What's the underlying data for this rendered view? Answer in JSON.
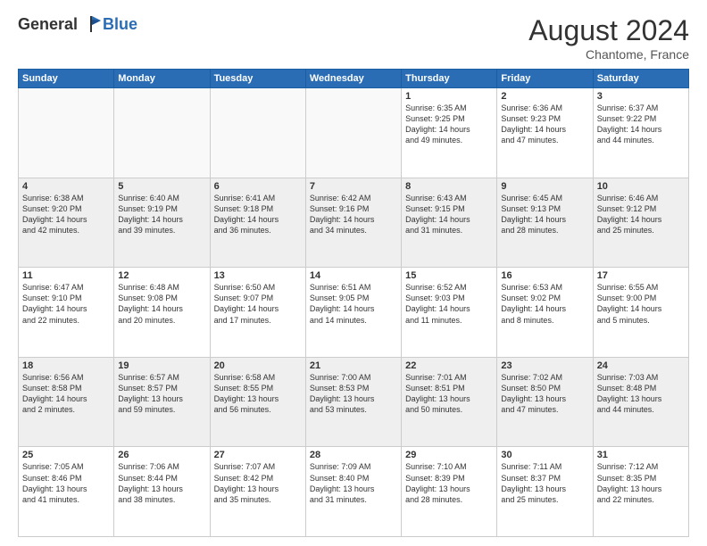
{
  "header": {
    "logo_general": "General",
    "logo_blue": "Blue",
    "month_title": "August 2024",
    "location": "Chantome, France"
  },
  "weekdays": [
    "Sunday",
    "Monday",
    "Tuesday",
    "Wednesday",
    "Thursday",
    "Friday",
    "Saturday"
  ],
  "rows": [
    [
      {
        "num": "",
        "info": ""
      },
      {
        "num": "",
        "info": ""
      },
      {
        "num": "",
        "info": ""
      },
      {
        "num": "",
        "info": ""
      },
      {
        "num": "1",
        "info": "Sunrise: 6:35 AM\nSunset: 9:25 PM\nDaylight: 14 hours\nand 49 minutes."
      },
      {
        "num": "2",
        "info": "Sunrise: 6:36 AM\nSunset: 9:23 PM\nDaylight: 14 hours\nand 47 minutes."
      },
      {
        "num": "3",
        "info": "Sunrise: 6:37 AM\nSunset: 9:22 PM\nDaylight: 14 hours\nand 44 minutes."
      }
    ],
    [
      {
        "num": "4",
        "info": "Sunrise: 6:38 AM\nSunset: 9:20 PM\nDaylight: 14 hours\nand 42 minutes."
      },
      {
        "num": "5",
        "info": "Sunrise: 6:40 AM\nSunset: 9:19 PM\nDaylight: 14 hours\nand 39 minutes."
      },
      {
        "num": "6",
        "info": "Sunrise: 6:41 AM\nSunset: 9:18 PM\nDaylight: 14 hours\nand 36 minutes."
      },
      {
        "num": "7",
        "info": "Sunrise: 6:42 AM\nSunset: 9:16 PM\nDaylight: 14 hours\nand 34 minutes."
      },
      {
        "num": "8",
        "info": "Sunrise: 6:43 AM\nSunset: 9:15 PM\nDaylight: 14 hours\nand 31 minutes."
      },
      {
        "num": "9",
        "info": "Sunrise: 6:45 AM\nSunset: 9:13 PM\nDaylight: 14 hours\nand 28 minutes."
      },
      {
        "num": "10",
        "info": "Sunrise: 6:46 AM\nSunset: 9:12 PM\nDaylight: 14 hours\nand 25 minutes."
      }
    ],
    [
      {
        "num": "11",
        "info": "Sunrise: 6:47 AM\nSunset: 9:10 PM\nDaylight: 14 hours\nand 22 minutes."
      },
      {
        "num": "12",
        "info": "Sunrise: 6:48 AM\nSunset: 9:08 PM\nDaylight: 14 hours\nand 20 minutes."
      },
      {
        "num": "13",
        "info": "Sunrise: 6:50 AM\nSunset: 9:07 PM\nDaylight: 14 hours\nand 17 minutes."
      },
      {
        "num": "14",
        "info": "Sunrise: 6:51 AM\nSunset: 9:05 PM\nDaylight: 14 hours\nand 14 minutes."
      },
      {
        "num": "15",
        "info": "Sunrise: 6:52 AM\nSunset: 9:03 PM\nDaylight: 14 hours\nand 11 minutes."
      },
      {
        "num": "16",
        "info": "Sunrise: 6:53 AM\nSunset: 9:02 PM\nDaylight: 14 hours\nand 8 minutes."
      },
      {
        "num": "17",
        "info": "Sunrise: 6:55 AM\nSunset: 9:00 PM\nDaylight: 14 hours\nand 5 minutes."
      }
    ],
    [
      {
        "num": "18",
        "info": "Sunrise: 6:56 AM\nSunset: 8:58 PM\nDaylight: 14 hours\nand 2 minutes."
      },
      {
        "num": "19",
        "info": "Sunrise: 6:57 AM\nSunset: 8:57 PM\nDaylight: 13 hours\nand 59 minutes."
      },
      {
        "num": "20",
        "info": "Sunrise: 6:58 AM\nSunset: 8:55 PM\nDaylight: 13 hours\nand 56 minutes."
      },
      {
        "num": "21",
        "info": "Sunrise: 7:00 AM\nSunset: 8:53 PM\nDaylight: 13 hours\nand 53 minutes."
      },
      {
        "num": "22",
        "info": "Sunrise: 7:01 AM\nSunset: 8:51 PM\nDaylight: 13 hours\nand 50 minutes."
      },
      {
        "num": "23",
        "info": "Sunrise: 7:02 AM\nSunset: 8:50 PM\nDaylight: 13 hours\nand 47 minutes."
      },
      {
        "num": "24",
        "info": "Sunrise: 7:03 AM\nSunset: 8:48 PM\nDaylight: 13 hours\nand 44 minutes."
      }
    ],
    [
      {
        "num": "25",
        "info": "Sunrise: 7:05 AM\nSunset: 8:46 PM\nDaylight: 13 hours\nand 41 minutes."
      },
      {
        "num": "26",
        "info": "Sunrise: 7:06 AM\nSunset: 8:44 PM\nDaylight: 13 hours\nand 38 minutes."
      },
      {
        "num": "27",
        "info": "Sunrise: 7:07 AM\nSunset: 8:42 PM\nDaylight: 13 hours\nand 35 minutes."
      },
      {
        "num": "28",
        "info": "Sunrise: 7:09 AM\nSunset: 8:40 PM\nDaylight: 13 hours\nand 31 minutes."
      },
      {
        "num": "29",
        "info": "Sunrise: 7:10 AM\nSunset: 8:39 PM\nDaylight: 13 hours\nand 28 minutes."
      },
      {
        "num": "30",
        "info": "Sunrise: 7:11 AM\nSunset: 8:37 PM\nDaylight: 13 hours\nand 25 minutes."
      },
      {
        "num": "31",
        "info": "Sunrise: 7:12 AM\nSunset: 8:35 PM\nDaylight: 13 hours\nand 22 minutes."
      }
    ]
  ]
}
